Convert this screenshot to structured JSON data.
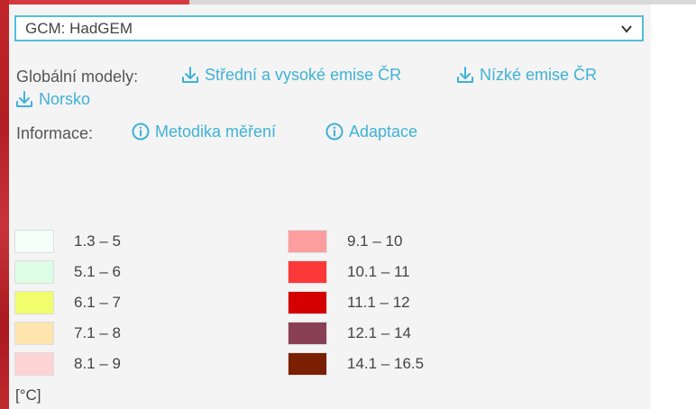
{
  "gcm_select": {
    "value": "GCM: HadGEM"
  },
  "global_models": {
    "label": "Globální modely:",
    "links": [
      {
        "label": "Střední a vysoké emise ČR",
        "icon": "download-icon"
      },
      {
        "label": "Nízké emise ČR",
        "icon": "download-icon"
      },
      {
        "label": "Norsko",
        "icon": "download-icon"
      }
    ]
  },
  "information": {
    "label": "Informace:",
    "links": [
      {
        "label": "Metodika měření",
        "icon": "info-icon"
      },
      {
        "label": "Adaptace",
        "icon": "info-icon"
      }
    ]
  },
  "legend": {
    "items": [
      {
        "label": "1.3 – 5",
        "color": "#f4fffa"
      },
      {
        "label": "5.1 – 6",
        "color": "#ddfde4"
      },
      {
        "label": "6.1 – 7",
        "color": "#f1fd6c"
      },
      {
        "label": "7.1 – 8",
        "color": "#fde5ad"
      },
      {
        "label": "8.1 – 9",
        "color": "#fdd3d3"
      },
      {
        "label": "9.1 – 10",
        "color": "#fd9e9e"
      },
      {
        "label": "10.1 – 11",
        "color": "#fd3838"
      },
      {
        "label": "11.1 – 12",
        "color": "#d40000"
      },
      {
        "label": "12.1 – 14",
        "color": "#894057"
      },
      {
        "label": "14.1 – 16.5",
        "color": "#7a2000"
      }
    ],
    "unit": "[°C]"
  },
  "colors": {
    "accent": "#3eb2d6",
    "select_border": "#52bfd9"
  }
}
